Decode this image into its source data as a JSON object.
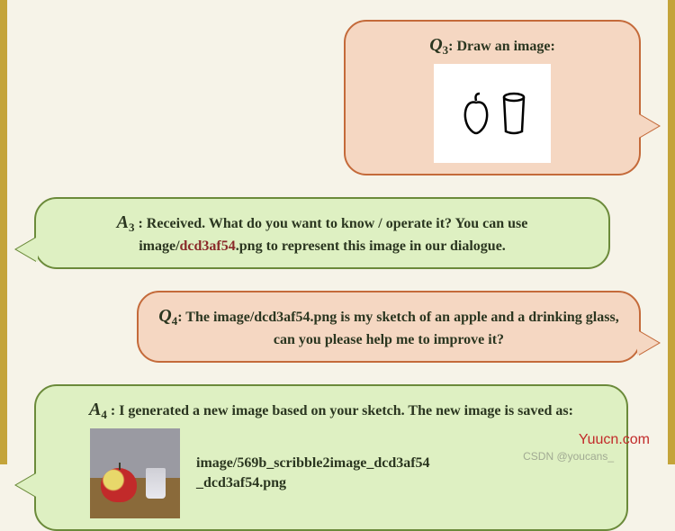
{
  "q3": {
    "label_sym": "Q",
    "label_sub": "3",
    "text": ": Draw an image:"
  },
  "a3": {
    "label_sym": "A",
    "label_sub": "3",
    "pre": " : Received.  What do you want to know / operate it? You can use image/",
    "hash": "dcd3af54",
    "post": ".png to represent this image in our dialogue."
  },
  "q4": {
    "label_sym": "Q",
    "label_sub": "4",
    "text": ": The image/dcd3af54.png is my sketch of an apple and a drinking glass, can you please help me to improve it?"
  },
  "a4": {
    "label_sym": "A",
    "label_sub": "4",
    "line1": " : I generated a new image based on your sketch. The new image is saved as:",
    "path1": "image/569b_scribble2image_dcd3af54",
    "path2": "_dcd3af54.png"
  },
  "watermark": "Yuucn.com",
  "csdn": "CSDN @youcans_"
}
